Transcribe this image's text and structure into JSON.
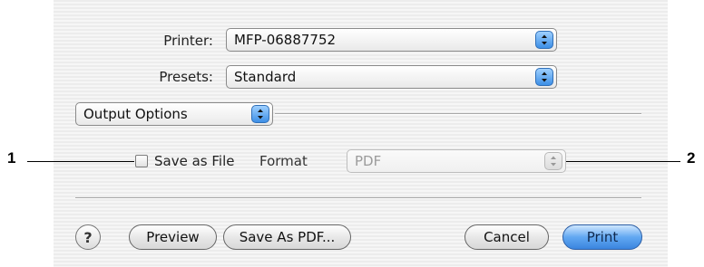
{
  "printer": {
    "label": "Printer:",
    "value": "MFP-06887752"
  },
  "presets": {
    "label": "Presets:",
    "value": "Standard"
  },
  "panel": {
    "value": "Output Options"
  },
  "save_as_file": {
    "label": "Save as File",
    "checked": false
  },
  "format": {
    "label": "Format",
    "value": "PDF"
  },
  "buttons": {
    "help": "?",
    "preview": "Preview",
    "save_as_pdf": "Save As PDF...",
    "cancel": "Cancel",
    "print": "Print"
  },
  "callouts": {
    "left": "1",
    "right": "2"
  },
  "colors": {
    "accent": "#3a85df",
    "stripe": "#ececec"
  }
}
